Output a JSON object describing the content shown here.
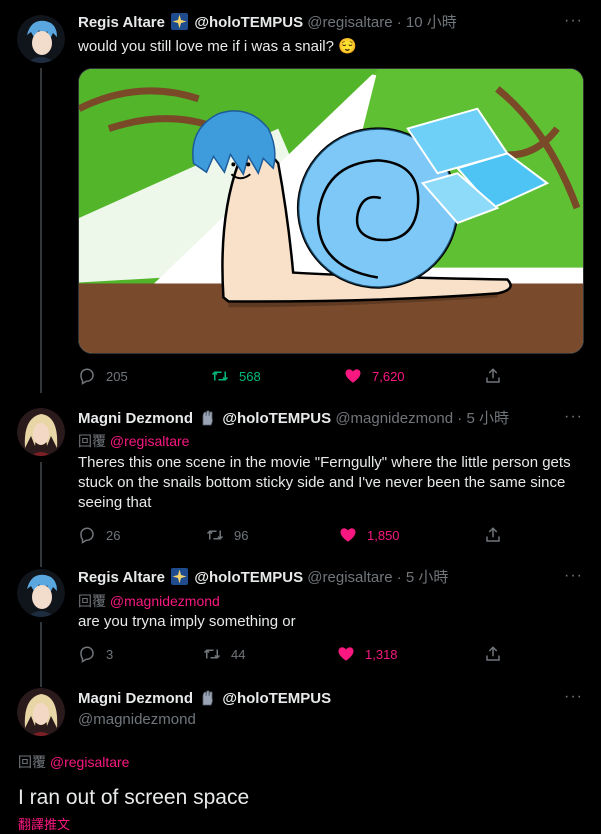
{
  "tweets": [
    {
      "name": "Regis Altare",
      "badge_icon": "star-sparkle-badge-icon",
      "team": "@holoTEMPUS",
      "handle": "@regisaltare",
      "time": "· 10 小時",
      "text": "would you still love me if i was a snail? 😌",
      "media_description": "drawing of a snail with blue hair and a cyan shell",
      "replies": "205",
      "retweets": "568",
      "likes": "7,620"
    },
    {
      "name": "Magni Dezmond",
      "badge_icon": "gauntlet-icon",
      "team": "@holoTEMPUS",
      "handle": "@magnidezmond",
      "time": "· 5 小時",
      "reply_prefix": "回覆",
      "reply_mention": "@regisaltare",
      "text": "Theres this one scene in the movie \"Ferngully\" where the little person gets stuck on the snails bottom sticky side and I've never been the same since seeing that",
      "replies": "26",
      "retweets": "96",
      "likes": "1,850"
    },
    {
      "name": "Regis Altare",
      "badge_icon": "star-sparkle-badge-icon",
      "team": "@holoTEMPUS",
      "handle": "@regisaltare",
      "time": "· 5 小時",
      "reply_prefix": "回覆",
      "reply_mention": "@magnidezmond",
      "text": "are you tryna imply something or",
      "replies": "3",
      "retweets": "44",
      "likes": "1,318"
    },
    {
      "name": "Magni Dezmond",
      "badge_icon": "gauntlet-icon",
      "team": "@holoTEMPUS",
      "handle": "@magnidezmond",
      "reply_prefix": "回覆",
      "reply_mention": "@regisaltare",
      "text": "I ran out of screen space",
      "translate": "翻譯推文"
    }
  ],
  "more_icon": "···",
  "colors": {
    "accent": "#f91880",
    "retweet": "#00ba7c",
    "muted": "#71767b",
    "background": "#000000"
  }
}
